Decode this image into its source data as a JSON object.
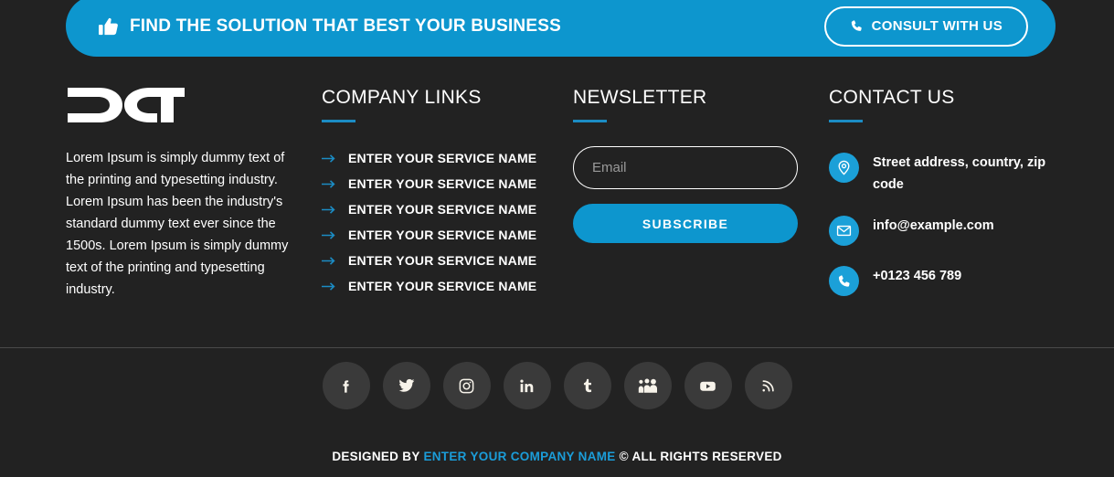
{
  "colors": {
    "background": "#222222",
    "accent_blue": "#0d96ce",
    "accent_rule": "#1b8cc4",
    "badge_blue": "#1ba0d8",
    "social_circle": "#3a3a3a",
    "divider": "#4a4a4a",
    "text_white": "#ffffff",
    "placeholder_gray": "#9a9a9a"
  },
  "cta": {
    "icon": "thumbs-up-icon",
    "headline": "FIND THE SOLUTION THAT BEST YOUR BUSINESS",
    "button_icon": "phone-icon",
    "button_label": "CONSULT WITH US"
  },
  "about": {
    "logo_text": "DCT",
    "description": "Lorem Ipsum is simply dummy text of the printing and typesetting industry. Lorem Ipsum has been the industry's standard dummy text ever since the 1500s. Lorem Ipsum is simply dummy text of the printing and typesetting industry."
  },
  "company_links": {
    "heading": "COMPANY LINKS",
    "bullet_icon": "arrow-right-icon",
    "items": [
      {
        "label": "ENTER YOUR SERVICE NAME"
      },
      {
        "label": "ENTER YOUR SERVICE NAME"
      },
      {
        "label": "ENTER YOUR SERVICE NAME"
      },
      {
        "label": "ENTER YOUR SERVICE NAME"
      },
      {
        "label": "ENTER YOUR SERVICE NAME"
      },
      {
        "label": "ENTER YOUR SERVICE NAME"
      }
    ]
  },
  "newsletter": {
    "heading": "NEWSLETTER",
    "email_placeholder": "Email",
    "email_value": "",
    "subscribe_label": "SUBSCRIBE"
  },
  "contact": {
    "heading": "CONTACT US",
    "items": [
      {
        "icon": "location-pin-icon",
        "text": "Street address, country, zip code"
      },
      {
        "icon": "envelope-icon",
        "text": "info@example.com"
      },
      {
        "icon": "phone-icon",
        "text": "+0123 456 789"
      }
    ]
  },
  "social": {
    "items": [
      {
        "name": "facebook"
      },
      {
        "name": "twitter"
      },
      {
        "name": "instagram"
      },
      {
        "name": "linkedin"
      },
      {
        "name": "tumblr"
      },
      {
        "name": "myspace"
      },
      {
        "name": "youtube"
      },
      {
        "name": "rss"
      }
    ]
  },
  "copyright": {
    "prefix": "DESIGNED BY ",
    "brand": "ENTER YOUR COMPANY NAME",
    "suffix": " © ALL RIGHTS RESERVED"
  }
}
